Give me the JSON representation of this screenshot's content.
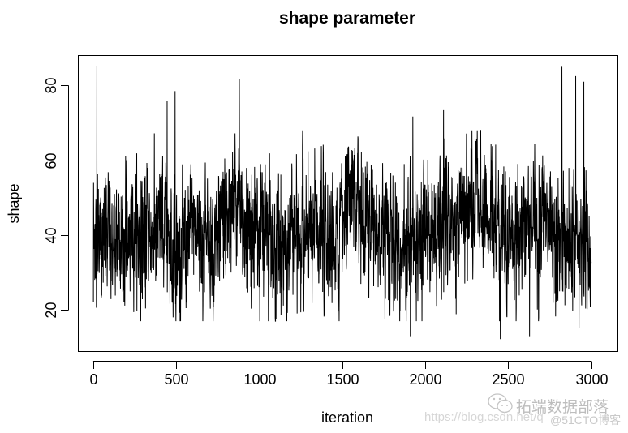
{
  "chart_data": {
    "type": "line",
    "title": "shape parameter",
    "xlabel": "iteration",
    "ylabel": "shape",
    "xlim": [
      -90,
      3160
    ],
    "ylim": [
      8.9,
      88
    ],
    "x_ticks": [
      0,
      500,
      1000,
      1500,
      2000,
      2500,
      3000
    ],
    "x_tick_labels": [
      "0",
      "500",
      "1000",
      "1500",
      "2000",
      "2500",
      "3000"
    ],
    "y_ticks": [
      20,
      40,
      60,
      80
    ],
    "y_tick_labels": [
      "20",
      "40",
      "60",
      "80"
    ],
    "grid": false,
    "legend": "none",
    "series": [
      {
        "name": "shape",
        "color": "#000000",
        "n_points": 3000,
        "x_range": [
          1,
          3000
        ],
        "mean": 40,
        "typical_range": [
          20,
          65
        ],
        "notable_points": [
          {
            "x": 22,
            "y": 85.2
          },
          {
            "x": 445,
            "y": 75.8
          },
          {
            "x": 493,
            "y": 78.5
          },
          {
            "x": 880,
            "y": 81.6
          },
          {
            "x": 1910,
            "y": 13.0
          },
          {
            "x": 1925,
            "y": 71.7
          },
          {
            "x": 2110,
            "y": 73.4
          },
          {
            "x": 2452,
            "y": 12.2
          },
          {
            "x": 2628,
            "y": 13.0
          },
          {
            "x": 2823,
            "y": 85.0
          },
          {
            "x": 2906,
            "y": 82.5
          },
          {
            "x": 2926,
            "y": 15.3
          },
          {
            "x": 2955,
            "y": 81.0
          }
        ]
      }
    ]
  },
  "watermark": {
    "brand": "拓端数据部落",
    "url": "https://blog.csdn.net/q",
    "source": "@51CTO博客",
    "icon": "wechat-icon"
  }
}
